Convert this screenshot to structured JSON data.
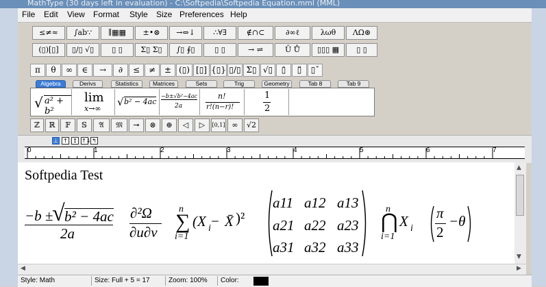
{
  "window": {
    "title": "MathType (30 days left in evaluation) - C:\\Softpedia\\Softpedia Equation.mml (MML)",
    "title_color": "#6a8fb8"
  },
  "menu": [
    "File",
    "Edit",
    "View",
    "Format",
    "Style",
    "Size",
    "Preferences",
    "Help"
  ],
  "palette_row1": [
    "≤≠≈",
    "∫ab∵",
    "∥▦▦",
    "±•⊗",
    "→⇔↓",
    "∴∀∃",
    "∉∩⊂",
    "∂∞ℓ",
    "λωθ",
    "ΛΩ⊛"
  ],
  "palette_row2": [
    "(▯)[▯]",
    "▯/▯ √▯",
    "▯ ▯",
    "Σ▯ Σ▯",
    "∫▯ ∮▯",
    "▯ ▯",
    "→ ⇌",
    "Ū Ů",
    "▯▯▯ ▦",
    "▯ ▯"
  ],
  "symbol_row": [
    "π",
    "θ",
    "∞",
    "∈",
    "→",
    "∂",
    "≤",
    "≠",
    "±",
    "(▯)",
    "[▯]",
    "{▯}",
    "▯/▯",
    "Σ▯",
    "√▯",
    "▯̇",
    "▯̈",
    "▯ˇ"
  ],
  "tabs": [
    "Algebra",
    "Derivs",
    "Statistics",
    "Matrices",
    "Sets",
    "Trig",
    "Geometry",
    "Tab 8",
    "Tab 9"
  ],
  "active_tab": "Algebra",
  "templates": {
    "t1": {
      "radical": "a² + b²"
    },
    "t2": {
      "top": "lim",
      "bottom": "x→∞"
    },
    "t3": {
      "radical": "b² − 4ac"
    },
    "t4": {
      "numerator": "−b±√b²−4ac",
      "denominator": "2a"
    },
    "t5": {
      "numerator": "n!",
      "denominator": "r!(n−r)!"
    },
    "t6": {
      "numerator": "1",
      "denominator": "2"
    }
  },
  "small_row": [
    "ℤ",
    "ℝ",
    "𝔽",
    "𝕊",
    "𝔄",
    "𝔐",
    "⊸",
    "⊗",
    "⊕",
    "◁",
    "▷",
    "[0,1]",
    "∞",
    "√2"
  ],
  "ruler": {
    "tab_buttons": [
      "⊥",
      "↑",
      "↥",
      "↑↓",
      "↰"
    ],
    "numbers": [
      "0",
      "1",
      "2",
      "3",
      "4",
      "5",
      "6",
      "7"
    ]
  },
  "editor": {
    "heading": "Softpedia Test",
    "quadratic": {
      "numerator_pre": "−b ±",
      "radical": "b² − 4ac",
      "denominator": "2a"
    },
    "partial": {
      "numerator": "∂²Ω",
      "denominator": "∂u∂v"
    },
    "sum": {
      "upper": "n",
      "symbol": "∑",
      "lower": "i=1",
      "body": "(X",
      "sub": "i",
      "minus": " − ",
      "xbar": "X̄",
      "close": ")²"
    },
    "matrix": {
      "cells": [
        [
          "a11",
          "a12",
          "a13"
        ],
        [
          "a21",
          "a22",
          "a23"
        ],
        [
          "a31",
          "a32",
          "a33"
        ]
      ]
    },
    "intersection": {
      "upper": "n",
      "symbol": "⋂",
      "lower": "i=1",
      "body": "X",
      "sub": "i"
    },
    "paren": {
      "numerator": "π",
      "denominator": "2",
      "tail": "−θ"
    }
  },
  "status": {
    "style": "Style: Math",
    "size": "Size: Full + 5 = 17",
    "zoom": "Zoom: 100%",
    "color_label": "Color:",
    "color_value": "#000000"
  }
}
